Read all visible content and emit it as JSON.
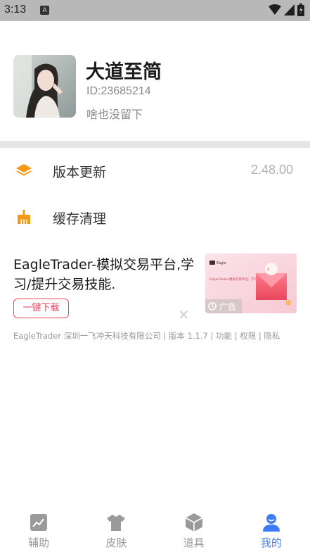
{
  "status_bar": {
    "time": "3:13",
    "app_indicator": "A"
  },
  "profile": {
    "nickname": "大道至简",
    "user_id": "ID:23685214",
    "signature": "啥也没留下"
  },
  "menu": [
    {
      "label": "版本更新",
      "value": "2.48.00",
      "icon": "layers-icon",
      "icon_color": "#f49a16"
    },
    {
      "label": "缓存清理",
      "value": "",
      "icon": "broom-icon",
      "icon_color": "#f49a16"
    }
  ],
  "ad": {
    "title": "EagleTrader-模拟交易平台,学习/提升交易技能.",
    "button": "一键下载",
    "image_badge": "广告",
    "image_caption": "EagleTrader-模拟交易平台，学习/提升交易技能。",
    "footer": "EagleTrader 深圳一飞冲天科技有限公司 | 版本 1.1.7 | 功能 | 权限 | 隐私",
    "brand_color": "#e8475c"
  },
  "tabs": [
    {
      "label": "辅助",
      "icon": "chart-icon",
      "active": false
    },
    {
      "label": "皮肤",
      "icon": "shirt-icon",
      "active": false
    },
    {
      "label": "道具",
      "icon": "box-icon",
      "active": false
    },
    {
      "label": "我的",
      "icon": "user-icon",
      "active": true
    }
  ],
  "colors": {
    "accent": "#3d7cf5",
    "inactive": "#9a9a9a",
    "orange": "#f49a16"
  }
}
